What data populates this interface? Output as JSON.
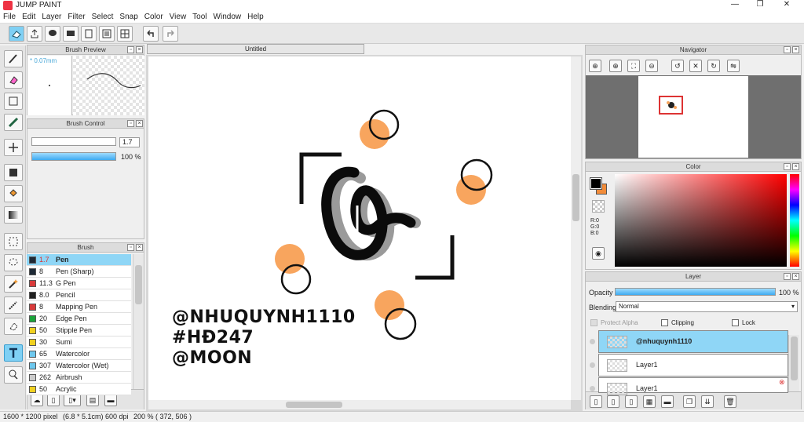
{
  "app": {
    "title": "JUMP PAINT",
    "minimize": "—",
    "maximize": "❐",
    "close": "✕"
  },
  "menu": [
    "File",
    "Edit",
    "Layer",
    "Filter",
    "Select",
    "Snap",
    "Color",
    "View",
    "Tool",
    "Window",
    "Help"
  ],
  "document": {
    "tab_title": "Untitled"
  },
  "brush_preview": {
    "title": "Brush Preview",
    "size_label": "* 0.07mm"
  },
  "brush_control": {
    "title": "Brush Control",
    "size_value": "1.7",
    "opacity_value": "100 %",
    "opacity_fraction": 1.0
  },
  "brush": {
    "title": "Brush",
    "items": [
      {
        "size": "1.7",
        "name": "Pen",
        "color": "#1e2a36",
        "selected": true
      },
      {
        "size": "8",
        "name": "Pen (Sharp)",
        "color": "#1e2a36"
      },
      {
        "size": "11.3",
        "name": "G Pen",
        "color": "#d83a3a"
      },
      {
        "size": "8.0",
        "name": "Pencil",
        "color": "#222222"
      },
      {
        "size": "8",
        "name": "Mapping Pen",
        "color": "#d83a3a"
      },
      {
        "size": "20",
        "name": "Edge Pen",
        "color": "#1aa33a"
      },
      {
        "size": "50",
        "name": "Stipple Pen",
        "color": "#f0d020"
      },
      {
        "size": "30",
        "name": "Sumi",
        "color": "#f0d020"
      },
      {
        "size": "65",
        "name": "Watercolor",
        "color": "#6ec8ee"
      },
      {
        "size": "307",
        "name": "Watercolor (Wet)",
        "color": "#6ec8ee"
      },
      {
        "size": "262",
        "name": "Airbrush",
        "color": "#cccccc"
      },
      {
        "size": "50",
        "name": "Acrylic",
        "color": "#f0d020"
      }
    ]
  },
  "artwork": {
    "watermark_lines": [
      "@NHUQUYNH1110",
      "#HĐ247",
      "@MOON"
    ]
  },
  "navigator": {
    "title": "Navigator"
  },
  "color": {
    "title": "Color",
    "r": "R:0",
    "g": "G:0",
    "b": "B:0",
    "fg": "#000000",
    "bg": "#f28c3a"
  },
  "layer": {
    "title": "Layer",
    "opacity_label": "Opacity",
    "opacity_value": "100 %",
    "opacity_fraction": 1.0,
    "blending_label": "Blending",
    "blending_value": "Normal",
    "protect_alpha": "Protect Alpha",
    "clipping": "Clipping",
    "lock": "Lock",
    "items": [
      {
        "name": "@nhuquynh1110",
        "selected": true
      },
      {
        "name": "Layer1"
      },
      {
        "name": "Layer1"
      }
    ]
  },
  "status": {
    "size": "1600 * 1200 pixel",
    "cm": "(6.8 * 5.1cm)",
    "dpi": "600 dpi",
    "zoom": "200 %",
    "coords": "( 372, 506 )"
  }
}
